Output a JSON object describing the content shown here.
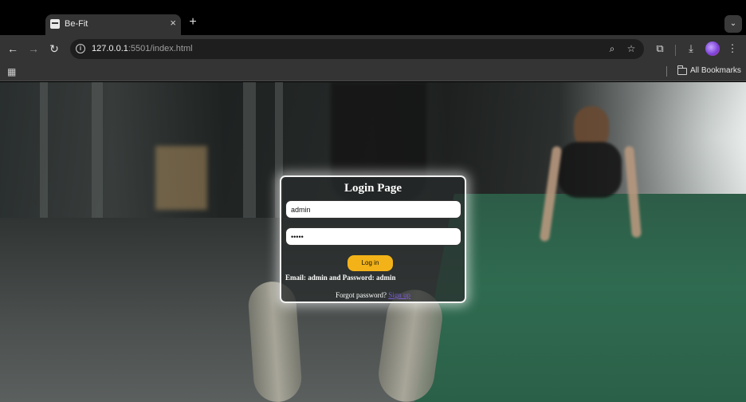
{
  "browser": {
    "tab_title": "Be-Fit",
    "new_tab_glyph": "+",
    "tab_close_glyph": "×",
    "url_host": "127.0.0.1",
    "url_rest": ":5501/index.html",
    "bookmarks_label": "All Bookmarks",
    "icons": [
      "back-icon",
      "forward-icon",
      "reload-icon",
      "site-info-icon",
      "zoom-icon",
      "star-icon",
      "extensions-icon",
      "download-icon",
      "menu-icon",
      "apps-icon",
      "folder-icon",
      "tab-search-icon"
    ]
  },
  "login": {
    "title": "Login Page",
    "email_value": "admin",
    "password_value": "•••••",
    "button_label": "Log in",
    "hint": "Email: admin and Password: admin",
    "forgot_text": "Forgot password?",
    "signup_link": "Sign up"
  },
  "colors": {
    "button": "#f3b318",
    "link": "#7e5bd6",
    "card_border": "#f2f2f2"
  }
}
